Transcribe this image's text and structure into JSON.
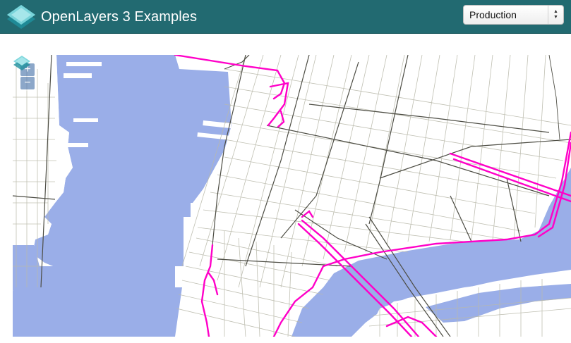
{
  "navbar": {
    "title": "OpenLayers 3 Examples",
    "mode_select": {
      "selected": "Production"
    }
  },
  "map": {
    "controls": {
      "zoom_in": "+",
      "zoom_out": "−"
    },
    "colors": {
      "water": "#9aaee8",
      "land": "#ffffff",
      "minor_road": "#b8b8a8",
      "major_road": "#4a4a40",
      "highway": "#ff00c8"
    }
  }
}
